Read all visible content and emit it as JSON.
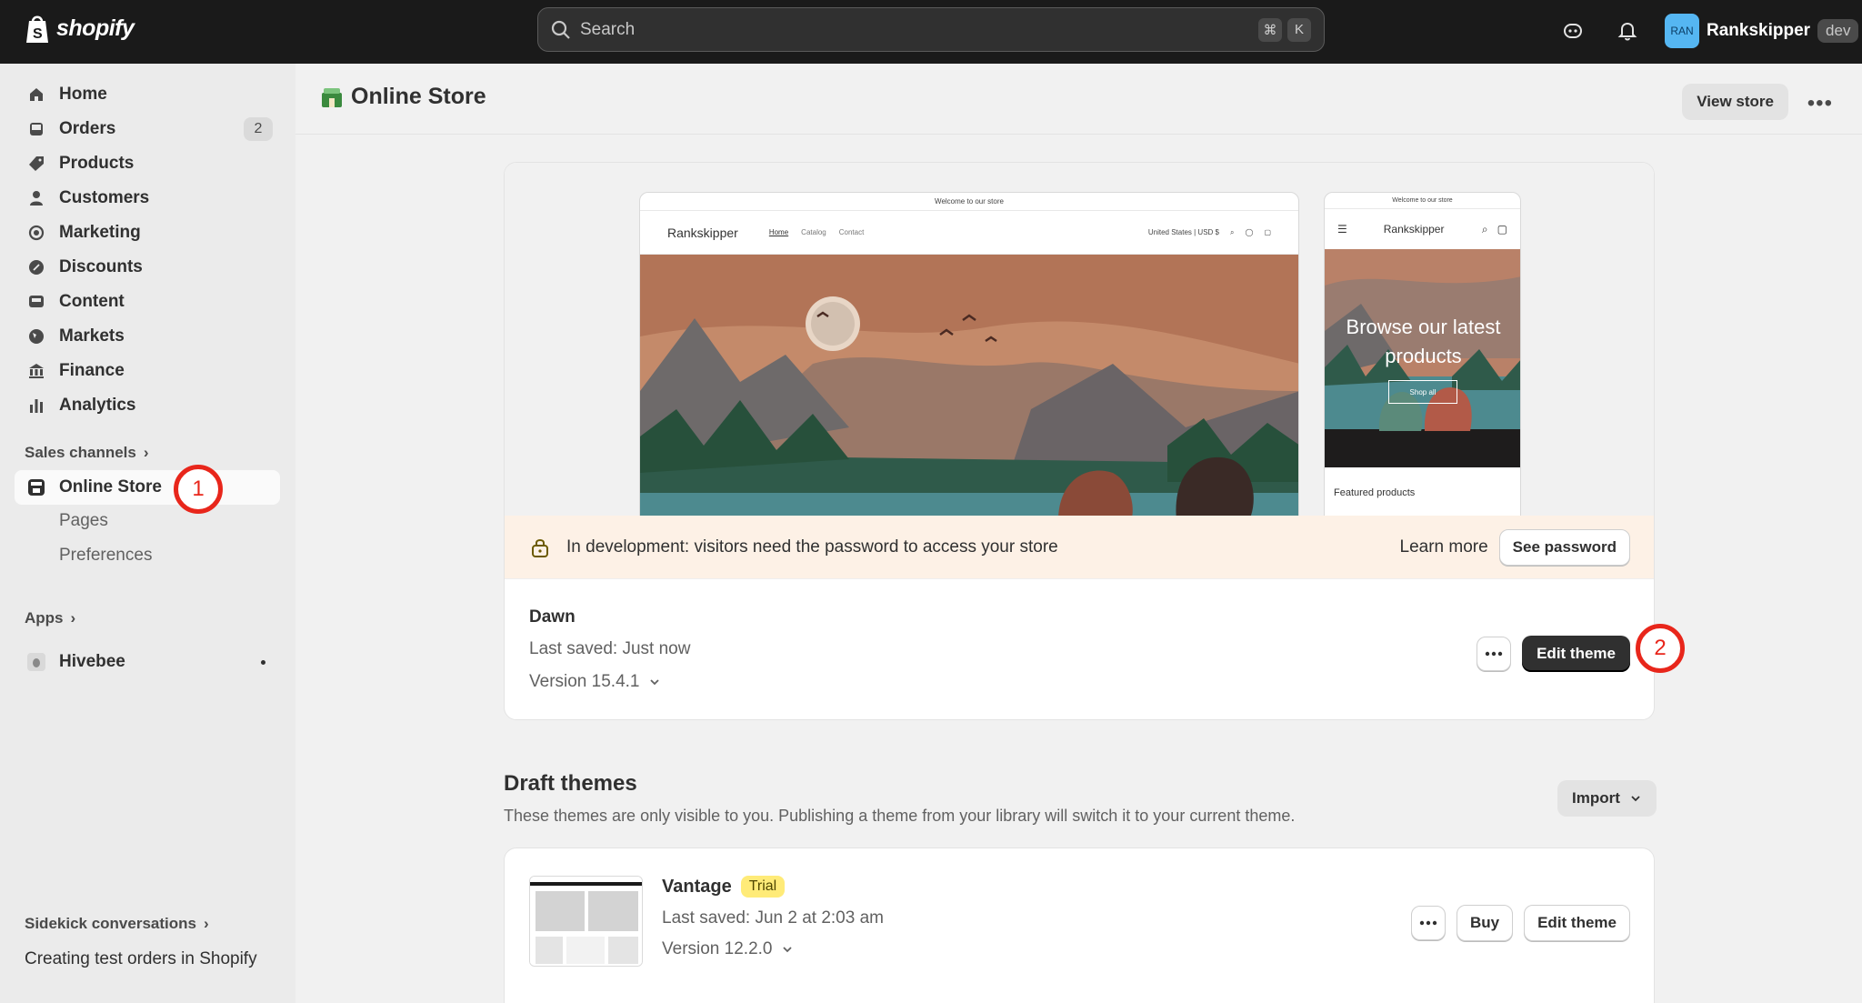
{
  "topbar": {
    "brand": "shopify",
    "search_placeholder": "Search",
    "shortcut_cmd": "⌘",
    "shortcut_key": "K",
    "user_initials": "RAN",
    "user_name": "Rankskipper",
    "env_badge": "dev"
  },
  "sidebar": {
    "items": [
      {
        "label": "Home",
        "icon": "home-icon"
      },
      {
        "label": "Orders",
        "icon": "inbox-icon",
        "count": "2"
      },
      {
        "label": "Products",
        "icon": "tag-icon"
      },
      {
        "label": "Customers",
        "icon": "person-icon"
      },
      {
        "label": "Marketing",
        "icon": "target-icon"
      },
      {
        "label": "Discounts",
        "icon": "discount-icon"
      },
      {
        "label": "Content",
        "icon": "image-icon"
      },
      {
        "label": "Markets",
        "icon": "globe-icon"
      },
      {
        "label": "Finance",
        "icon": "bank-icon"
      },
      {
        "label": "Analytics",
        "icon": "bar-chart-icon"
      }
    ],
    "sales_channels_label": "Sales channels",
    "online_store_label": "Online Store",
    "sub_items": [
      "Pages",
      "Preferences"
    ],
    "apps_label": "Apps",
    "app_item": "Hivebee",
    "sidekick_label": "Sidekick conversations",
    "conversation": "Creating test orders in Shopify"
  },
  "markers": {
    "one": "1",
    "two": "2"
  },
  "header": {
    "title": "Online Store",
    "view_store": "View store"
  },
  "preview": {
    "announcement": "Welcome to our store",
    "store_name": "Rankskipper",
    "nav_links": [
      "Home",
      "Catalog",
      "Contact"
    ],
    "locale": "United States | USD $",
    "hero_heading": "Browse our latest products",
    "shop_all": "Shop all",
    "featured": "Featured products"
  },
  "banner": {
    "text": "In development: visitors need the password to access your store",
    "learn_more": "Learn more",
    "see_password": "See password"
  },
  "current_theme": {
    "name": "Dawn",
    "saved": "Last saved: Just now",
    "version": "Version 15.4.1",
    "edit": "Edit theme"
  },
  "drafts": {
    "title": "Draft themes",
    "description": "These themes are only visible to you. Publishing a theme from your library will switch it to your current theme.",
    "import": "Import",
    "theme": {
      "name": "Vantage",
      "badge": "Trial",
      "saved": "Last saved: Jun 2 at 2:03 am",
      "version": "Version 12.2.0",
      "buy": "Buy",
      "edit": "Edit theme"
    }
  },
  "colors": {
    "topbar": "#1a1a1a",
    "marker": "#e8261b",
    "banner": "#fdf1e6",
    "trial_badge": "#ffeb78"
  }
}
